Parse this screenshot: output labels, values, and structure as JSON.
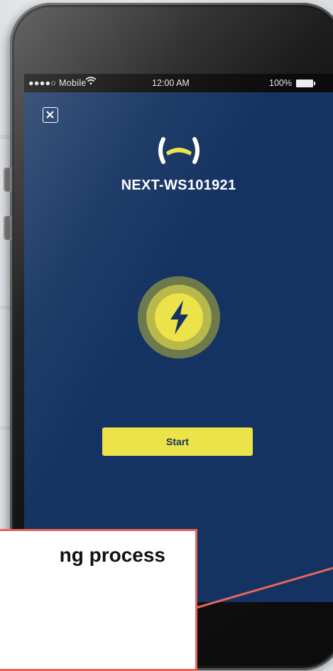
{
  "status_bar": {
    "carrier": "●●●●○ Mobile",
    "time": "12:00 AM",
    "battery": "100%"
  },
  "screen": {
    "close_icon": "close-icon",
    "logo_icon": "brand-logo-icon",
    "device_name": "NEXT-WS101921",
    "power_icon": "lightning-bolt-icon",
    "start_label": "Start"
  },
  "callout": {
    "text": "ng process"
  },
  "colors": {
    "screen_bg": "#153362",
    "accent_yellow": "#ece24a",
    "callout_border": "#e8655a"
  }
}
